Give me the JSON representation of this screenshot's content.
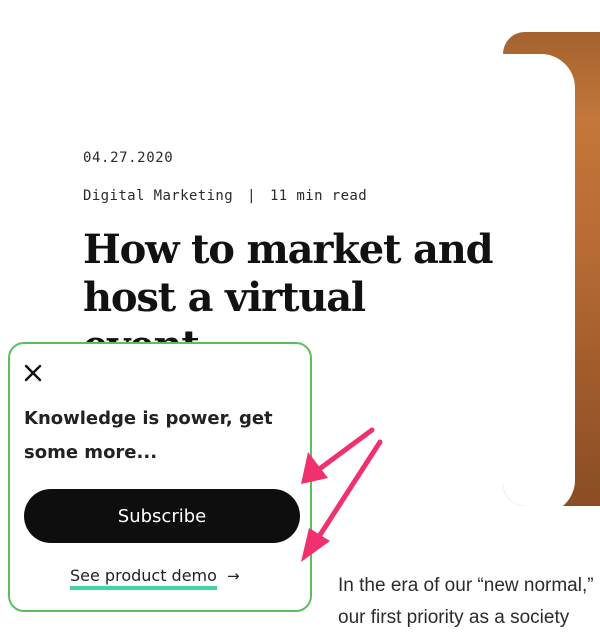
{
  "article": {
    "date": "04.27.2020",
    "category": "Digital Marketing",
    "separator": "|",
    "read_time": "11 min read",
    "title": "How to market and host a virtual event",
    "body_lines": [
      "In the era of our “new normal,”",
      "our first priority as a society"
    ]
  },
  "popup": {
    "close_icon": "close-icon",
    "heading": "Knowledge is power, get some more...",
    "subscribe_label": "Subscribe",
    "demo_link_label": "See product demo",
    "demo_arrow": "→",
    "border_color": "#5bbf5e",
    "link_underline_color": "#3fd6a4"
  },
  "annotation": {
    "arrow_color": "#f0316e",
    "arrow_count": 2
  }
}
